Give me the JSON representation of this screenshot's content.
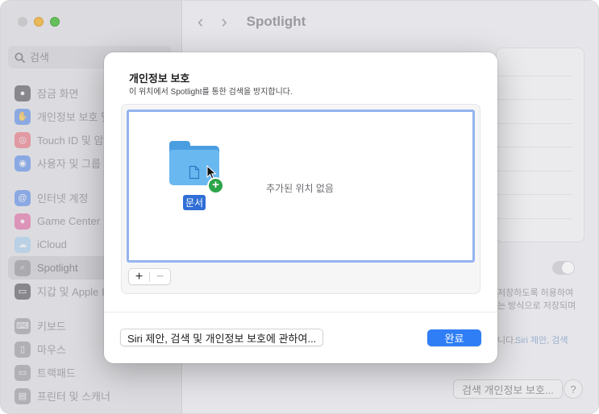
{
  "window": {
    "nav_back": "‹",
    "nav_forward": "›",
    "title": "Spotlight"
  },
  "sidebar": {
    "search_placeholder": "검색",
    "items": [
      {
        "label": "잠금 화면",
        "icon": "lock-icon",
        "color": "#3a3a3c"
      },
      {
        "label": "개인정보 보호 및",
        "icon": "hand-icon",
        "color": "#3d7ef0"
      },
      {
        "label": "Touch ID 및 암",
        "icon": "fingerprint-icon",
        "color": "#f05d6a"
      },
      {
        "label": "사용자 및 그룹",
        "icon": "users-icon",
        "color": "#3d7ef0"
      },
      {
        "label": "인터넷 계정",
        "icon": "at-icon",
        "color": "#3d7ef0"
      },
      {
        "label": "Game Center",
        "icon": "game-center-icon",
        "color": "#e8559a"
      },
      {
        "label": "iCloud",
        "icon": "cloud-icon",
        "color": "#9fd0f5"
      },
      {
        "label": "Spotlight",
        "icon": "spotlight-search-icon",
        "color": "#8e8e93"
      },
      {
        "label": "지갑 및 Apple I",
        "icon": "wallet-icon",
        "color": "#3a3a3c"
      },
      {
        "label": "키보드",
        "icon": "keyboard-icon",
        "color": "#8e8e93"
      },
      {
        "label": "마우스",
        "icon": "mouse-icon",
        "color": "#8e8e93"
      },
      {
        "label": "트랙패드",
        "icon": "trackpad-icon",
        "color": "#8e8e93"
      },
      {
        "label": "프린터 및 스캐너",
        "icon": "printer-icon",
        "color": "#8e8e93"
      }
    ]
  },
  "background": {
    "text_line1": "저장하도록 허용하여",
    "text_line2": "는 방식으로 저장되며",
    "text_line3": "니다.",
    "link": "Siri 제안, 검색",
    "privacy_button": "검색 개인정보 보호...",
    "help_button": "?"
  },
  "sheet": {
    "title": "개인정보 보호",
    "subtitle": "이 위치에서 Spotlight를 통한 검색을 방지합니다.",
    "dragged_item_label": "문서",
    "empty_text": "추가된 위치 없음",
    "add_button": "+",
    "remove_button": "−",
    "about_button": "Siri 제안, 검색 및 개인정보 보호에 관하여...",
    "done_button": "완료"
  },
  "colors": {
    "accent": "#2f7ef6",
    "drop_highlight": "#94b4ee",
    "folder": "#6ab8f0",
    "add_badge": "#2ca44a",
    "selection_label": "#2f6fd6"
  }
}
